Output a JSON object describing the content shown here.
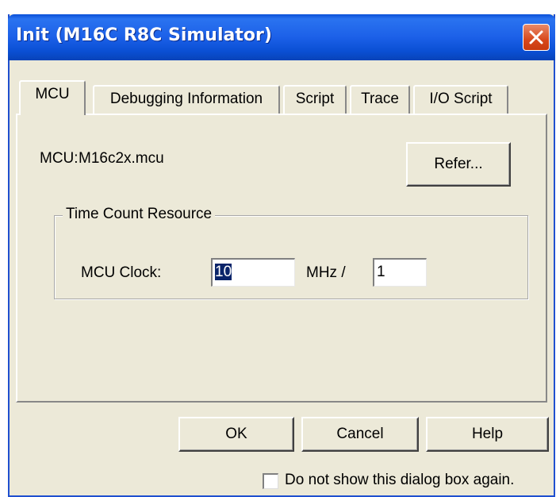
{
  "window": {
    "title": "Init (M16C R8C Simulator)"
  },
  "titlebar": {
    "close_icon": "close-icon"
  },
  "tabs": [
    {
      "label": "MCU",
      "active": true
    },
    {
      "label": "Debugging Information",
      "active": false
    },
    {
      "label": "Script",
      "active": false
    },
    {
      "label": "Trace",
      "active": false
    },
    {
      "label": "I/O Script",
      "active": false
    }
  ],
  "mcu": {
    "label": "MCU:",
    "value": "M16c2x.mcu",
    "refer_button": "Refer..."
  },
  "time_count": {
    "group_title": "Time Count Resource",
    "clock_label": "MCU Clock:",
    "clock_value": "10",
    "unit_label": "MHz /",
    "divider_value": "1"
  },
  "buttons": {
    "ok": "OK",
    "cancel": "Cancel",
    "help": "Help"
  },
  "dont_show": {
    "label": "Do not show this dialog box again.",
    "checked": false
  },
  "colors": {
    "titlebar": "#0a50d8",
    "close_button": "#d8481c",
    "dialog_face": "#ece9d8",
    "selection": "#0a246a"
  }
}
